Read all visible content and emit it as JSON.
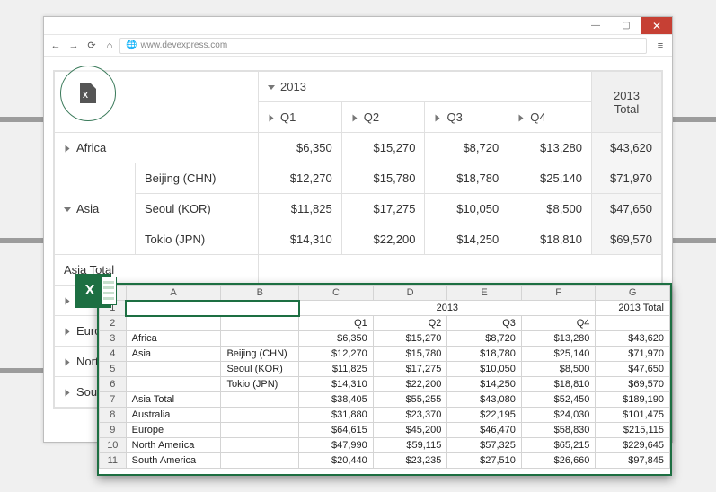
{
  "browser": {
    "url": "www.devexpress.com",
    "min": "—",
    "max": "▢",
    "close": "✕",
    "back": "←",
    "forward": "→",
    "reload": "⟳",
    "home": "⌂",
    "menu": "≡",
    "globe": "🌐"
  },
  "export": {
    "x": "X"
  },
  "pivot": {
    "year": "2013",
    "total_label": "2013 Total",
    "q": [
      "Q1",
      "Q2",
      "Q3",
      "Q4"
    ],
    "rows": [
      {
        "label": "Africa",
        "vals": [
          "$6,350",
          "$15,270",
          "$8,720",
          "$13,280"
        ],
        "total": "$43,620",
        "expandable": true,
        "open": false
      },
      {
        "label": "Asia",
        "vals": [
          "$12,270",
          "$15,780",
          "$18,780",
          "$25,140"
        ],
        "total": "$71,970",
        "expandable": true,
        "open": true,
        "city": "Beijing (CHN)"
      },
      {
        "city_only": true,
        "city": "Seoul (KOR)",
        "vals": [
          "$11,825",
          "$17,275",
          "$10,050",
          "$8,500"
        ],
        "total": "$47,650"
      },
      {
        "city_only": true,
        "city": "Tokio (JPN)",
        "vals": [
          "$14,310",
          "$22,200",
          "$14,250",
          "$18,810"
        ],
        "total": "$69,570"
      },
      {
        "label": "Asia Total",
        "cut": true
      },
      {
        "label": "Australia",
        "cut": true,
        "expandable": true
      },
      {
        "label": "Europe",
        "cut": true,
        "expandable": true
      },
      {
        "label": "North America",
        "cut": true,
        "expandable": true
      },
      {
        "label": "South America",
        "cut": true,
        "expandable": true
      }
    ]
  },
  "excel": {
    "cols": [
      "A",
      "B",
      "C",
      "D",
      "E",
      "F",
      "G"
    ],
    "header_year": "2013",
    "header_total": "2013 Total",
    "q": [
      "Q1",
      "Q2",
      "Q3",
      "Q4"
    ],
    "rows": [
      {
        "n": "3",
        "a": "Africa",
        "b": "",
        "c": "$6,350",
        "d": "$15,270",
        "e": "$8,720",
        "f": "$13,280",
        "g": "$43,620"
      },
      {
        "n": "4",
        "a": "Asia",
        "b": "Beijing (CHN)",
        "c": "$12,270",
        "d": "$15,780",
        "e": "$18,780",
        "f": "$25,140",
        "g": "$71,970"
      },
      {
        "n": "5",
        "a": "",
        "b": "Seoul (KOR)",
        "c": "$11,825",
        "d": "$17,275",
        "e": "$10,050",
        "f": "$8,500",
        "g": "$47,650"
      },
      {
        "n": "6",
        "a": "",
        "b": "Tokio (JPN)",
        "c": "$14,310",
        "d": "$22,200",
        "e": "$14,250",
        "f": "$18,810",
        "g": "$69,570"
      },
      {
        "n": "7",
        "a": "Asia Total",
        "b": "",
        "c": "$38,405",
        "d": "$55,255",
        "e": "$43,080",
        "f": "$52,450",
        "g": "$189,190"
      },
      {
        "n": "8",
        "a": "Australia",
        "b": "",
        "c": "$31,880",
        "d": "$23,370",
        "e": "$22,195",
        "f": "$24,030",
        "g": "$101,475"
      },
      {
        "n": "9",
        "a": "Europe",
        "b": "",
        "c": "$64,615",
        "d": "$45,200",
        "e": "$46,470",
        "f": "$58,830",
        "g": "$215,115"
      },
      {
        "n": "10",
        "a": "North America",
        "b": "",
        "c": "$47,990",
        "d": "$59,115",
        "e": "$57,325",
        "f": "$65,215",
        "g": "$229,645"
      },
      {
        "n": "11",
        "a": "South America",
        "b": "",
        "c": "$20,440",
        "d": "$23,235",
        "e": "$27,510",
        "f": "$26,660",
        "g": "$97,845"
      }
    ]
  }
}
